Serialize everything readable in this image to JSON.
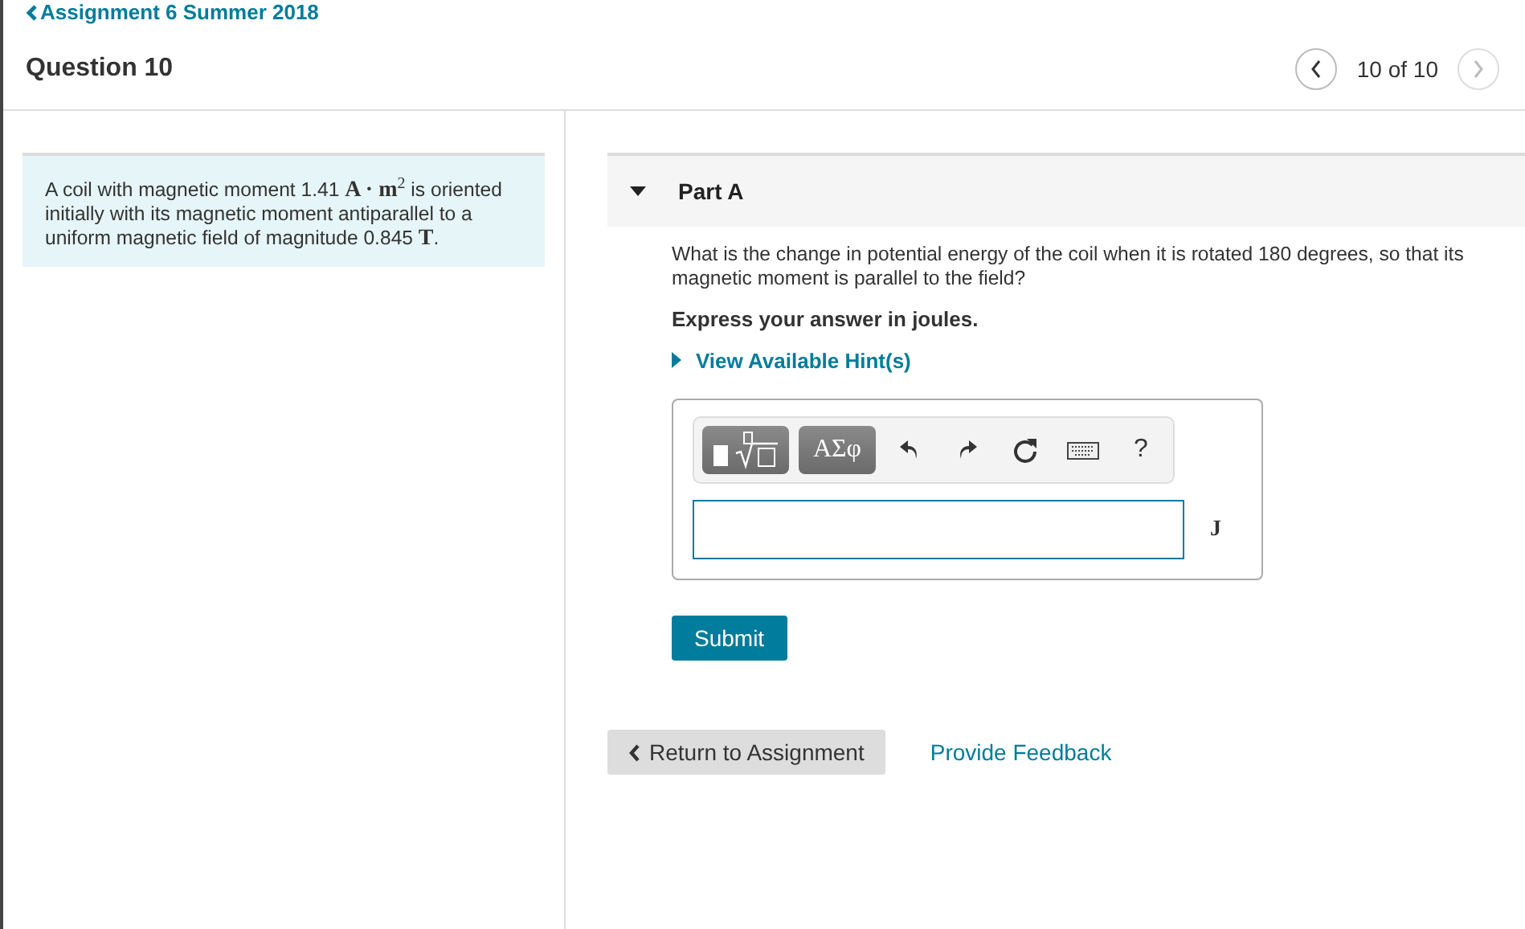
{
  "breadcrumb": "Assignment 6 Summer 2018",
  "question_title": "Question 10",
  "pager": {
    "position": "10 of 10",
    "prev_disabled": false,
    "next_disabled": true
  },
  "problem_text": "A coil with magnetic moment 1.41 **A · m**$^{2}$ is oriented initially with its magnetic moment antiparallel to a uniform magnetic field of magnitude 0.845 **T**.",
  "part": {
    "title": "Part A",
    "expanded": true,
    "question": "What is the change in potential energy of the coil when it is rotated 180 degrees, so that its magnetic moment is parallel to the field?",
    "instruction": "Express your answer in joules.",
    "hint": {
      "label": "View Available Hint(s)",
      "expanded": false
    },
    "toolbar": [
      {
        "kind": "templates"
      },
      {
        "kind": "text",
        "label": "ΑΣφ"
      },
      {
        "kind": "undo"
      },
      {
        "kind": "redo"
      },
      {
        "kind": "reset"
      },
      {
        "kind": "keyboard"
      },
      {
        "kind": "plain",
        "label": "?"
      }
    ],
    "answer": {
      "unit": "J"
    },
    "submit": "Submit"
  },
  "footer": {
    "return": "Return to Assignment",
    "feedback": "Provide Feedback"
  }
}
